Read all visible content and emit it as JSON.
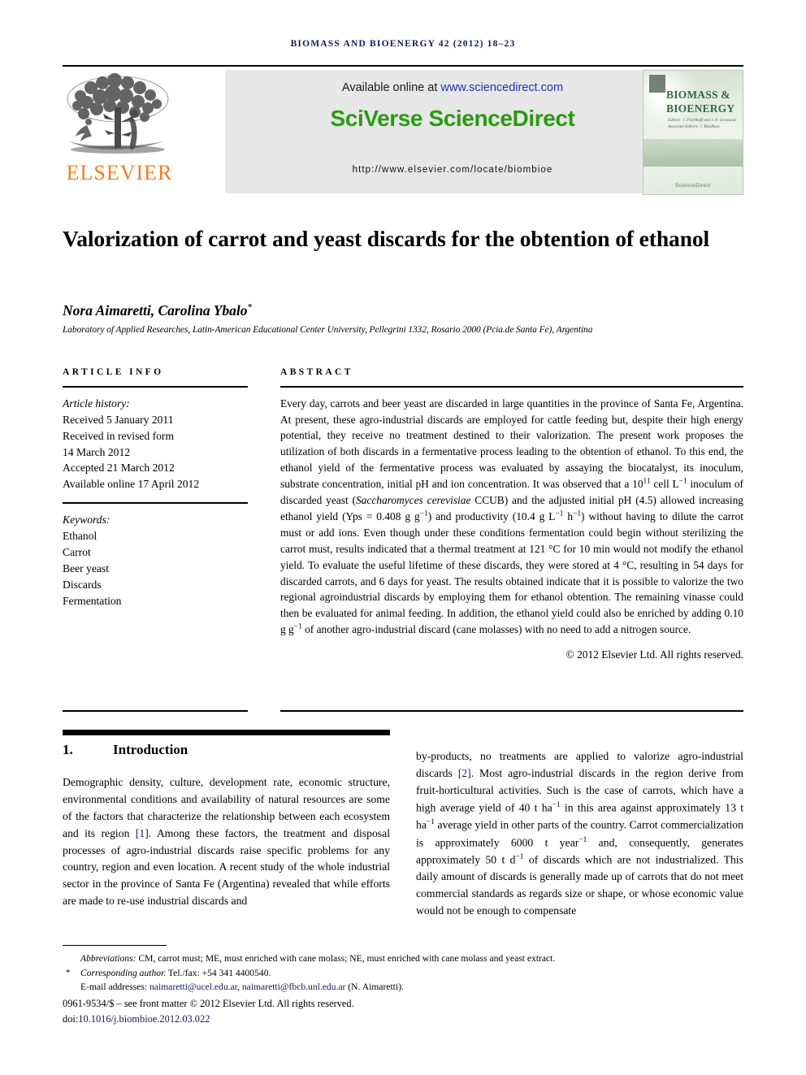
{
  "running_head": "Biomass and bioenergy 42 (2012) 18–23",
  "masthead": {
    "publisher_name": "ELSEVIER",
    "available_prefix": "Available online at ",
    "available_link": "www.sciencedirect.com",
    "platform_logo": "SciVerse ScienceDirect",
    "journal_url": "http://www.elsevier.com/locate/biombioe",
    "cover": {
      "title": "BIOMASS & BIOENERGY",
      "editors": "Editors: J. Fischhoff and J.-F. Grassaud\nAssociate Editors: J. Bardbury",
      "footer_mark": "ScienceDirect"
    }
  },
  "title": "Valorization of carrot and yeast discards for the obtention of ethanol",
  "authors": "Nora Aimaretti, Carolina Ybalo",
  "author_marker": "*",
  "affiliation": "Laboratory of Applied Researches, Latin-American Educational Center University, Pellegrini 1332, Rosario 2000 (Pcia.de Santa Fe), Argentina",
  "article_info": {
    "eyebrow": "Article info",
    "history_label": "Article history:",
    "history": [
      "Received 5 January 2011",
      "Received in revised form",
      "14 March 2012",
      "Accepted 21 March 2012",
      "Available online 17 April 2012"
    ],
    "keywords_label": "Keywords:",
    "keywords": [
      "Ethanol",
      "Carrot",
      "Beer yeast",
      "Discards",
      "Fermentation"
    ]
  },
  "abstract": {
    "eyebrow": "Abstract",
    "part1": "Every day, carrots and beer yeast are discarded in large quantities in the province of Santa Fe, Argentina. At present, these agro-industrial discards are employed for cattle feeding but, despite their high energy potential, they receive no treatment destined to their valorization. The present work proposes the utilization of both discards in a fermentative process leading to the obtention of ethanol. To this end, the ethanol yield of the fermentative process was evaluated by assaying the biocatalyst, its inoculum, substrate concentration, initial pH and ion concentration. It was observed that a 10",
    "sup1": "11",
    "part2": " cell L",
    "sup2": "−1",
    "part3": " inoculum of discarded yeast (",
    "species": "Saccharomyces cerevisiae",
    "part4": " CCUB) and the adjusted initial pH (4.5) allowed increasing ethanol yield (Yps = 0.408 g g",
    "sup3": "−1",
    "part5": ") and productivity (10.4 g L",
    "sup4": "−1",
    "part6": " h",
    "sup5": "−1",
    "part7": ") without having to dilute the carrot must or add ions. Even though under these conditions fermentation could begin without sterilizing the carrot must, results indicated that a thermal treatment at 121 °C for 10 min would not modify the ethanol yield. To evaluate the useful lifetime of these discards, they were stored at 4 °C, resulting in 54 days for discarded carrots, and 6 days for yeast. The results obtained indicate that it is possible to valorize the two regional agroindustrial discards by employing them for ethanol obtention. The remaining vinasse could then be evaluated for animal feeding. In addition, the ethanol yield could also be enriched by adding 0.10 g g",
    "sup6": "−1",
    "part8": " of another agro-industrial discard (cane molasses) with no need to add a nitrogen source.",
    "copyright": "© 2012 Elsevier Ltd. All rights reserved."
  },
  "body": {
    "section_number": "1.",
    "section_title": "Introduction",
    "left_part1": "Demographic density, culture, development rate, economic structure, environmental conditions and availability of natural resources are some of the factors that characterize the relationship between each ecosystem and its region ",
    "left_ref1": "[1]",
    "left_part2": ". Among these factors, the treatment and disposal processes of agro-industrial discards raise specific problems for any country, region and even location. A recent study of the whole industrial sector in the province of Santa Fe (Argentina) revealed that while efforts are made to re-use industrial discards and",
    "right_part1": "by-products, no treatments are applied to valorize agro-industrial discards ",
    "right_ref1": "[2]",
    "right_part2": ". Most agro-industrial discards in the region derive from fruit-horticultural activities. Such is the case of carrots, which have a high average yield of 40 t ha",
    "right_sup1": "−1",
    "right_part3": " in this area against approximately 13 t ha",
    "right_sup2": "−1",
    "right_part4": " average yield in other parts of the country. Carrot commercialization is approximately 6000 t year",
    "right_sup3": "−1",
    "right_part5": " and, consequently, generates approximately 50 t d",
    "right_sup4": "−1",
    "right_part6": " of discards which are not industrialized. This daily amount of discards is generally made up of carrots that do not meet commercial standards as regards size or shape, or whose economic value would not be enough to compensate"
  },
  "footnotes": {
    "abbrev_label": "Abbreviations:",
    "abbrev_text": " CM, carrot must; ME, must enriched with cane molass; NE, must enriched with cane molass and yeast extract.",
    "corr_marker": "*",
    "corr_label": "Corresponding author.",
    "corr_text": " Tel./fax: +54 341 4400540.",
    "email_label": "E-mail addresses: ",
    "email1": "naimaretti@ucel.edu.ar",
    "email_sep": ", ",
    "email2": "naimaretti@fbcb.unl.edu.ar",
    "email_suffix": " (N. Aimaretti).",
    "issn_line": "0961-9534/$ – see front matter © 2012 Elsevier Ltd. All rights reserved.",
    "doi_label": "doi:",
    "doi_value": "10.1016/j.biombioe.2012.03.022"
  },
  "colors": {
    "header_blue": "#13195e",
    "sciencedirect_green": "#2a9a12",
    "elsevier_orange": "#f07e26",
    "link_blue": "#2233aa"
  }
}
